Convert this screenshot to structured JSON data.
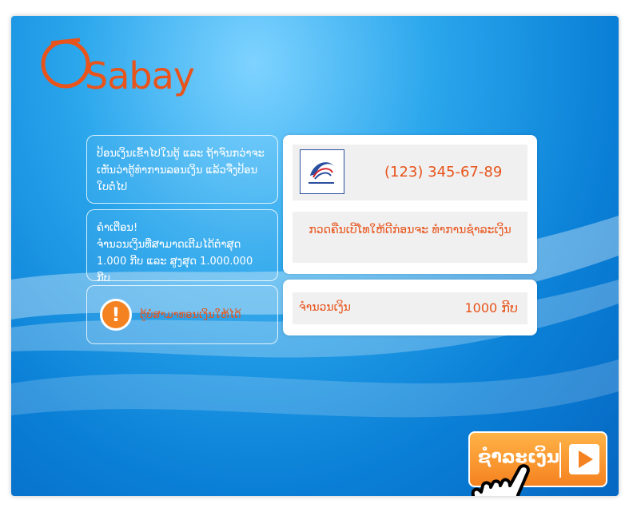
{
  "logo": {
    "text": "Sabay"
  },
  "left_panels": {
    "instructions": "ປ້ອນເງິນເຂົ້າໄປໃນຕູ້ ແລະ ຖ້າຈົນກວ່າຈະເຫັນວ່າຕູ້ທຳການລອນເງິນ ແລ້ວຈື່ງປ້ອນໃບຕໍ່ໄປ",
    "warning_title": "ຄຳເຕືອນ!",
    "warning_body": "ຈຳນວນເງິນທີ່ສາມາດເຕີມໄດ້ຕ່ຳສຸດ 1.000 ກີບ ແລະ ສູງສຸດ 1.000.000 ກີບ",
    "no_change_notice": "ຕູ້ບໍ່ສາມາທອນເງິນໃຫ້ໄດ້"
  },
  "operator": {
    "logo_name": "lao-telecom-logo",
    "logo_caption": "ລາວ ໂທລະຄົມ LAO TELECOM"
  },
  "phone_number": "(123) 345-67-89",
  "check_number_note": "ກວດຄືນເບີໂທໃຫ້ດີກ່ອນຈະ ທຳການຊຳລະເງິນ",
  "amount": {
    "label": "ຈຳນວນເງິນ",
    "value": "1000 ກີບ"
  },
  "pay_button": {
    "label": "ຊຳລະເງິນ",
    "icon": "play-arrow-icon"
  },
  "colors": {
    "accent": "#e8541b",
    "button": "#f58220",
    "background": "#1a8fe0"
  }
}
